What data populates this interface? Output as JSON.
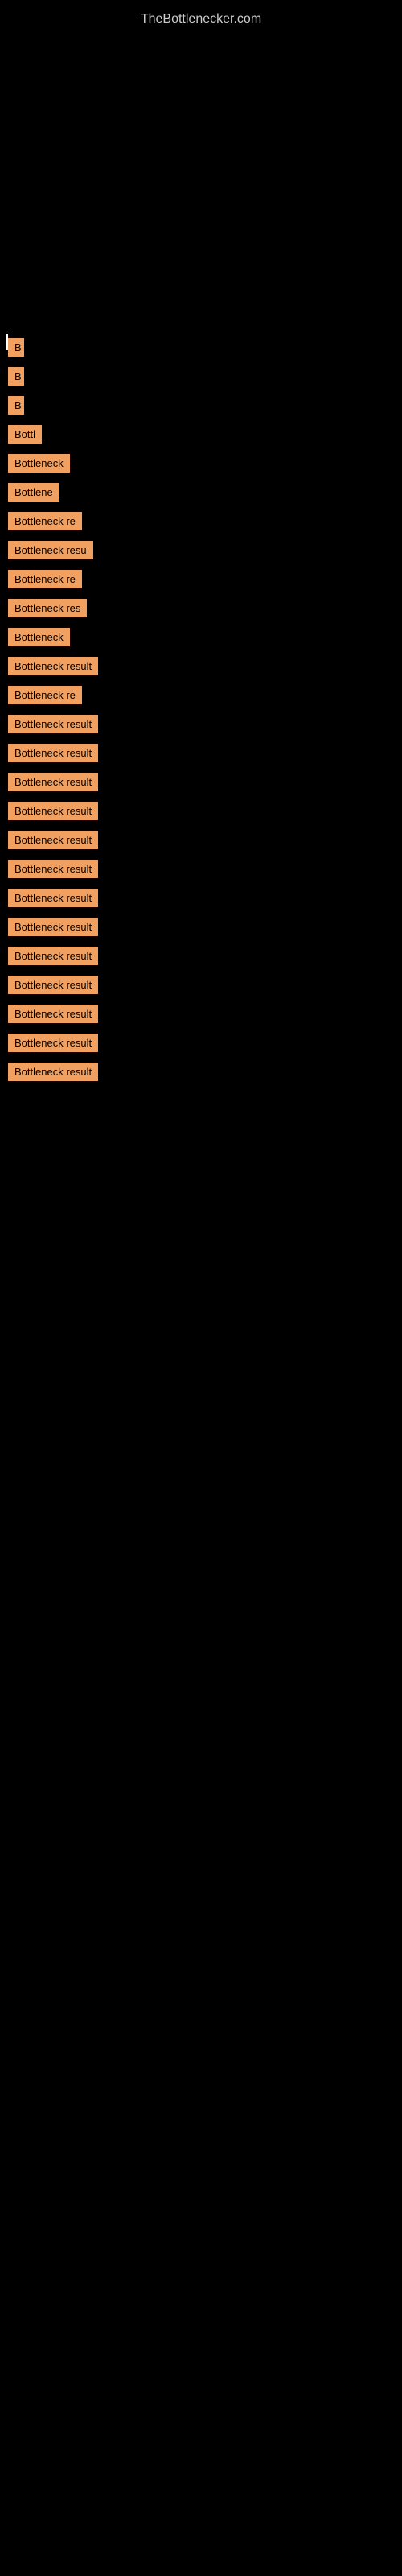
{
  "site": {
    "title": "TheBottlenecker.com"
  },
  "cursor": {
    "visible": true
  },
  "items": [
    {
      "id": 1,
      "label": "B",
      "width": 20
    },
    {
      "id": 2,
      "label": "B",
      "width": 20
    },
    {
      "id": 3,
      "label": "B",
      "width": 20
    },
    {
      "id": 4,
      "label": "Bottl",
      "width": 50
    },
    {
      "id": 5,
      "label": "Bottleneck",
      "width": 80
    },
    {
      "id": 6,
      "label": "Bottlene",
      "width": 70
    },
    {
      "id": 7,
      "label": "Bottleneck re",
      "width": 110
    },
    {
      "id": 8,
      "label": "Bottleneck resu",
      "width": 130
    },
    {
      "id": 9,
      "label": "Bottleneck re",
      "width": 110
    },
    {
      "id": 10,
      "label": "Bottleneck res",
      "width": 120
    },
    {
      "id": 11,
      "label": "Bottleneck",
      "width": 80
    },
    {
      "id": 12,
      "label": "Bottleneck result",
      "width": 145
    },
    {
      "id": 13,
      "label": "Bottleneck re",
      "width": 110
    },
    {
      "id": 14,
      "label": "Bottleneck result",
      "width": 145
    },
    {
      "id": 15,
      "label": "Bottleneck result",
      "width": 145
    },
    {
      "id": 16,
      "label": "Bottleneck result",
      "width": 145
    },
    {
      "id": 17,
      "label": "Bottleneck result",
      "width": 145
    },
    {
      "id": 18,
      "label": "Bottleneck result",
      "width": 145
    },
    {
      "id": 19,
      "label": "Bottleneck result",
      "width": 145
    },
    {
      "id": 20,
      "label": "Bottleneck result",
      "width": 145
    },
    {
      "id": 21,
      "label": "Bottleneck result",
      "width": 145
    },
    {
      "id": 22,
      "label": "Bottleneck result",
      "width": 145
    },
    {
      "id": 23,
      "label": "Bottleneck result",
      "width": 145
    },
    {
      "id": 24,
      "label": "Bottleneck result",
      "width": 145
    },
    {
      "id": 25,
      "label": "Bottleneck result",
      "width": 145
    },
    {
      "id": 26,
      "label": "Bottleneck result",
      "width": 145
    }
  ]
}
